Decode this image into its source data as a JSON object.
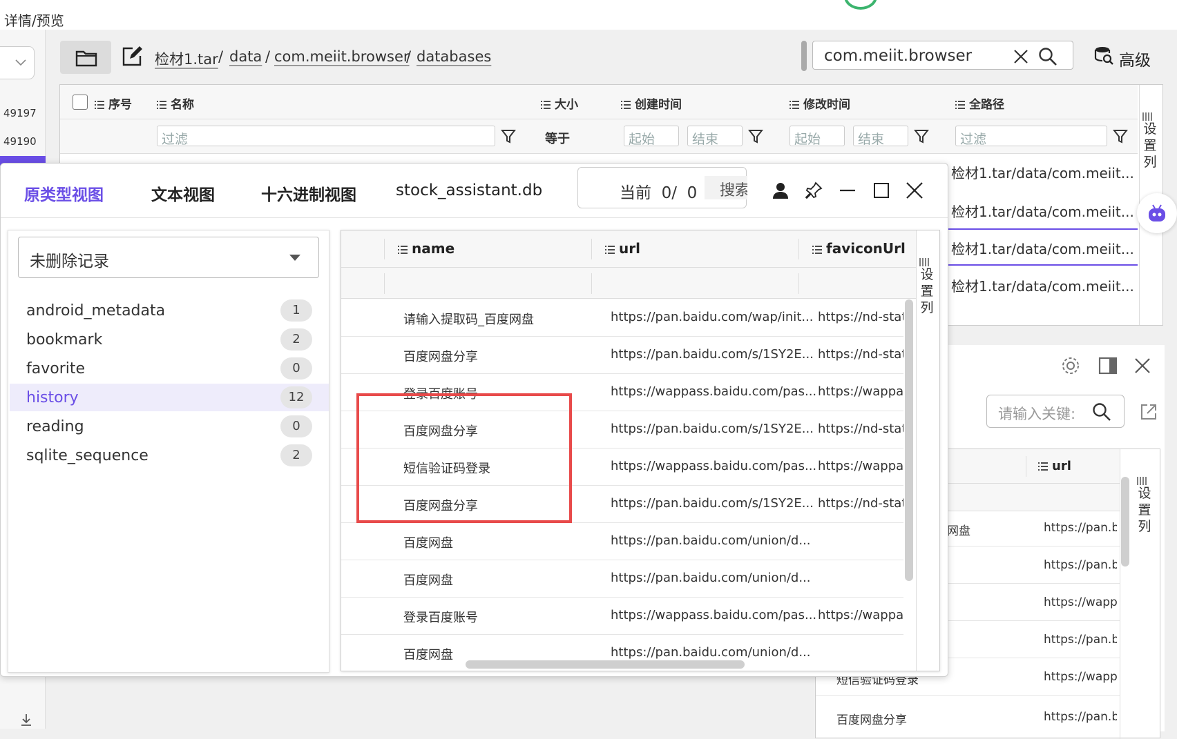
{
  "window": {
    "title": "详情/预览"
  },
  "left_nav": {
    "ids": [
      "49197",
      "49190"
    ]
  },
  "path_bar": {
    "crumbs": [
      "检材1.tar",
      "data",
      "com.meiit.browser",
      "databases"
    ],
    "separator": "/",
    "search_value": "com.meiit.browser",
    "advanced_label": "高级"
  },
  "file_table": {
    "columns": [
      "序号",
      "名称",
      "大小",
      "创建时间",
      "修改时间",
      "全路径"
    ],
    "filter_placeholder": "过滤",
    "size_op": "等于",
    "start_placeholder": "起始",
    "end_placeholder": "结束",
    "set_columns": [
      "设",
      "置",
      "列"
    ],
    "rows_fullpath": [
      "检材1.tar/data/com.meiit...",
      "检材1.tar/data/com.meiit...",
      "检材1.tar/data/com.meiit...",
      "检材1.tar/data/com.meiit..."
    ]
  },
  "side_panel": {
    "search_placeholder": "请输入关键:",
    "url_column": "url",
    "set_columns": [
      "设",
      "置",
      "列"
    ],
    "visible_cells": [
      "网盘",
      "https://pan.ba",
      "https://pan.ba",
      "https://wappa",
      "https://pan.ba",
      "短信验证码登录",
      "https://wappa",
      "百度网盘分享",
      "https://pan.ba"
    ]
  },
  "dialog": {
    "tabs": [
      "原类型视图",
      "文本视图",
      "十六进制视图"
    ],
    "file_name": "stock_assistant.db",
    "pager": {
      "label": "当前",
      "current": "0/",
      "total": "0",
      "search_label": "搜索"
    },
    "record_filter": "未删除记录",
    "tables": [
      {
        "name": "android_metadata",
        "count": "1"
      },
      {
        "name": "bookmark",
        "count": "2"
      },
      {
        "name": "favorite",
        "count": "0"
      },
      {
        "name": "history",
        "count": "12"
      },
      {
        "name": "reading",
        "count": "0"
      },
      {
        "name": "sqlite_sequence",
        "count": "2"
      }
    ],
    "selected_table": "history",
    "grid": {
      "columns": [
        "name",
        "url",
        "faviconUrl"
      ],
      "set_columns": [
        "设",
        "置",
        "列"
      ],
      "rows": [
        {
          "name": "请输入提取码_百度网盘",
          "url": "https://pan.baidu.com/wap/init...",
          "favicon": "https://nd-static"
        },
        {
          "name": "百度网盘分享",
          "url": "https://pan.baidu.com/s/1SY2E...",
          "favicon": "https://nd-static"
        },
        {
          "name": "登录百度账号",
          "url": "https://wappass.baidu.com/pas...",
          "favicon": "https://wappass"
        },
        {
          "name": "百度网盘分享",
          "url": "https://pan.baidu.com/s/1SY2E...",
          "favicon": "https://nd-static"
        },
        {
          "name": "短信验证码登录",
          "url": "https://wappass.baidu.com/pas...",
          "favicon": "https://wappass"
        },
        {
          "name": "百度网盘分享",
          "url": "https://pan.baidu.com/s/1SY2E...",
          "favicon": "https://nd-static"
        },
        {
          "name": "百度网盘",
          "url": "https://pan.baidu.com/union/d...",
          "favicon": ""
        },
        {
          "name": "百度网盘",
          "url": "https://pan.baidu.com/union/d...",
          "favicon": ""
        },
        {
          "name": "登录百度账号",
          "url": "https://wappass.baidu.com/pas...",
          "favicon": "https://wappass"
        },
        {
          "name": "百度网盘",
          "url": "https://pan.baidu.com/union/d...",
          "favicon": ""
        }
      ]
    }
  },
  "colors": {
    "accent": "#6a4ee6",
    "highlight_box": "#e84a4a"
  }
}
